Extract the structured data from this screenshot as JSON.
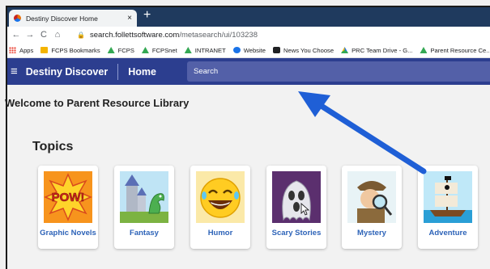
{
  "browser": {
    "tab_title": "Destiny Discover Home",
    "tab_close": "×",
    "new_tab": "+",
    "url_host": "search.follettsoftware.com",
    "url_path": "/metasearch/ui/103238",
    "nav": {
      "back": "←",
      "forward": "→",
      "reload": "C",
      "home": "⌂"
    }
  },
  "bookmarks": [
    {
      "label": "Apps",
      "icon": "apps-icon"
    },
    {
      "label": "FCPS Bookmarks",
      "icon": "folder-icon"
    },
    {
      "label": "FCPS",
      "icon": "fcps-icon"
    },
    {
      "label": "FCPSnet",
      "icon": "fcps-icon"
    },
    {
      "label": "INTRANET",
      "icon": "fcps-icon"
    },
    {
      "label": "Website",
      "icon": "website-icon"
    },
    {
      "label": "News You Choose",
      "icon": "chat-icon"
    },
    {
      "label": "PRC Team Drive - G...",
      "icon": "drive-icon"
    },
    {
      "label": "Parent Resource Ce...",
      "icon": "fcps-icon"
    }
  ],
  "header": {
    "menu_icon": "≡",
    "brand": "Destiny Discover",
    "home": "Home",
    "search_placeholder": "Search"
  },
  "main": {
    "welcome": "Welcome to Parent Resource Library",
    "topics_heading": "Topics",
    "topics": [
      {
        "label": "Graphic Novels"
      },
      {
        "label": "Fantasy"
      },
      {
        "label": "Humor"
      },
      {
        "label": "Scary Stories"
      },
      {
        "label": "Mystery"
      },
      {
        "label": "Adventure"
      }
    ]
  },
  "colors": {
    "tabbar": "#1f3a5e",
    "header": "#2c3e8f",
    "search": "#5360a8",
    "link": "#2d63b8",
    "arrow": "#1f5fd6"
  }
}
